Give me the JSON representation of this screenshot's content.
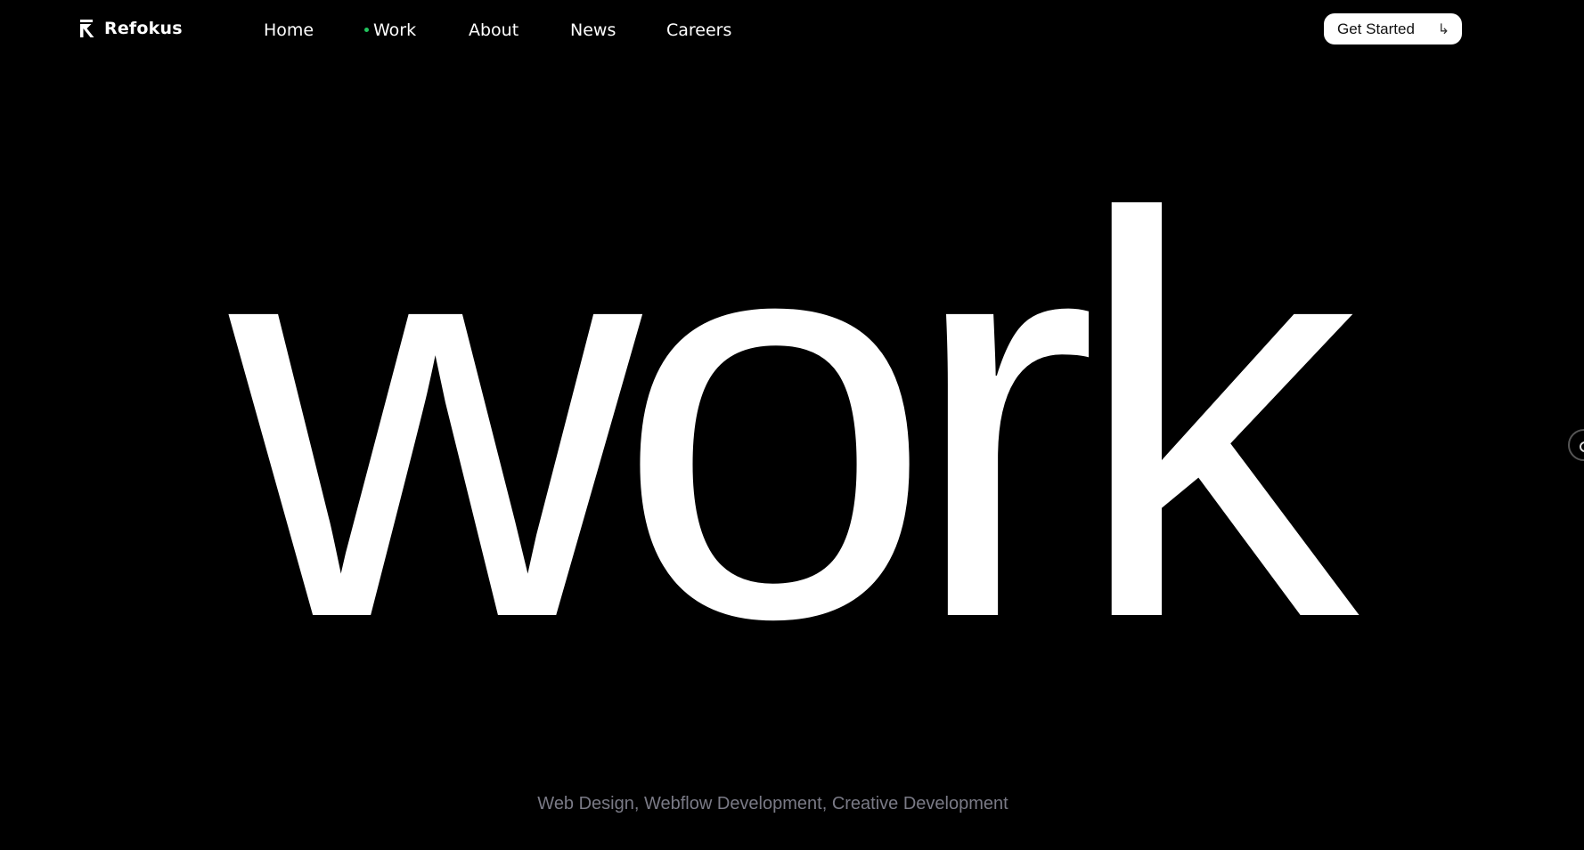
{
  "brand": {
    "name": "Refokus",
    "logo_icon": "refokus-arrow-logo-icon"
  },
  "nav": {
    "items": [
      {
        "label": "Home",
        "active": false
      },
      {
        "label": "Work",
        "active": true
      },
      {
        "label": "About",
        "active": false
      },
      {
        "label": "News",
        "active": false
      },
      {
        "label": "Careers",
        "active": false
      }
    ],
    "active_indicator_color": "#22c55e"
  },
  "cta": {
    "label": "Get Started",
    "icon": "return-arrow-icon"
  },
  "hero": {
    "title": "work",
    "tagline": "Web Design, Webflow Development, Creative Development"
  },
  "side_handle": {
    "icon": "circle-handle-icon"
  },
  "colors": {
    "background": "#000000",
    "text": "#ffffff",
    "tagline": "#7a7a86",
    "accent": "#22c55e"
  }
}
